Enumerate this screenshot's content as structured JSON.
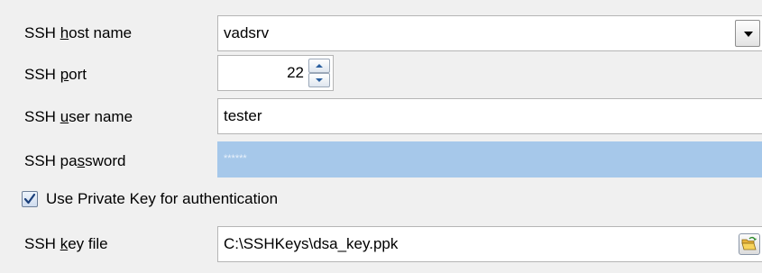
{
  "host": {
    "label_pre": "SSH ",
    "label_key": "h",
    "label_post": "ost name",
    "value": "vadsrv",
    "dropdown_icon": "chevron-down-icon"
  },
  "port": {
    "label_pre": "SSH ",
    "label_key": "p",
    "label_post": "ort",
    "value": "22",
    "spin_up_icon": "arrow-up-icon",
    "spin_down_icon": "arrow-down-icon"
  },
  "user": {
    "label_pre": "SSH ",
    "label_key": "u",
    "label_post": "ser name",
    "value": "tester"
  },
  "password": {
    "label_pre": "SSH pa",
    "label_key": "s",
    "label_post": "sword",
    "value": "******",
    "highlight_color": "#a6c8ea"
  },
  "private_key": {
    "label": "Use Private Key for authentication",
    "checked": true
  },
  "key_file": {
    "label_pre": "SSH ",
    "label_key": "k",
    "label_post": "ey file",
    "value": "C:\\SSHKeys\\dsa_key.ppk",
    "browse_icon": "open-folder-icon"
  }
}
